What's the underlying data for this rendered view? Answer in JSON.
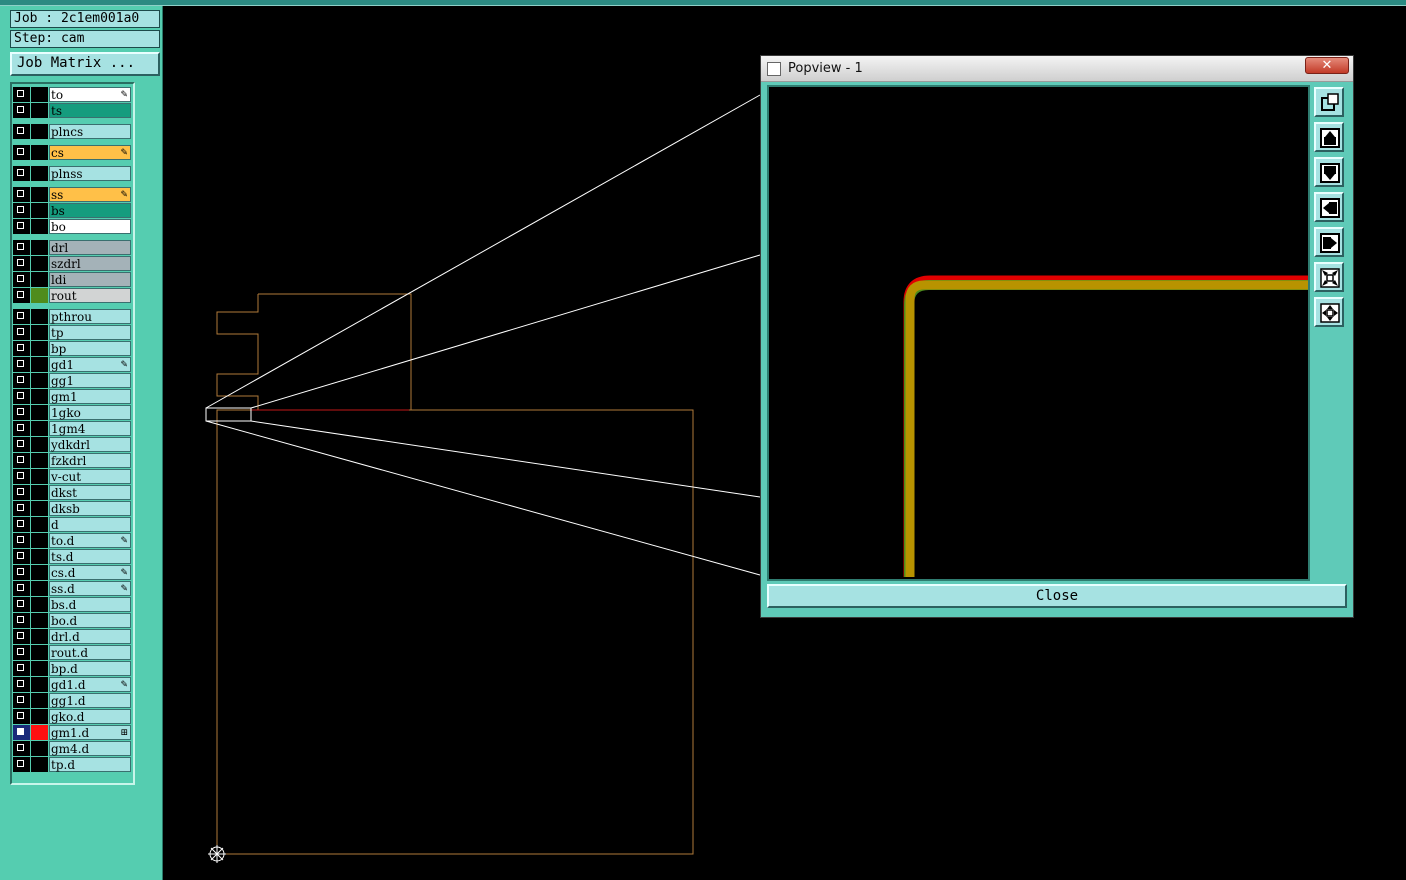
{
  "job": {
    "job_label": "Job : 2c1em001a0",
    "step_label": "Step: cam",
    "matrix_button": "Job Matrix ..."
  },
  "layers": [
    {
      "name": "to",
      "bg": "#ffffff",
      "edit": "✎",
      "checked": false,
      "swatch": ""
    },
    {
      "name": "ts",
      "bg": "#159c7e",
      "edit": "",
      "checked": false,
      "swatch": ""
    },
    {
      "name": "plncs",
      "bg": "#a6e2e2",
      "edit": "",
      "checked": false,
      "swatch": "",
      "gap": true
    },
    {
      "name": "cs",
      "bg": "#ffc048",
      "edit": "✎",
      "checked": false,
      "swatch": "",
      "gap": true
    },
    {
      "name": "plnss",
      "bg": "#a6e2e2",
      "edit": "",
      "checked": false,
      "swatch": "",
      "gap": true
    },
    {
      "name": "ss",
      "bg": "#ffc048",
      "edit": "✎",
      "checked": false,
      "swatch": "",
      "gap": true
    },
    {
      "name": "bs",
      "bg": "#159c7e",
      "edit": "",
      "checked": false,
      "swatch": ""
    },
    {
      "name": "bo",
      "bg": "#ffffff",
      "edit": "",
      "checked": false,
      "swatch": ""
    },
    {
      "name": "drl",
      "bg": "#a4b2b8",
      "edit": "",
      "checked": false,
      "swatch": "",
      "gap": true
    },
    {
      "name": "szdrl",
      "bg": "#a4b2b8",
      "edit": "",
      "checked": false,
      "swatch": ""
    },
    {
      "name": "ldi",
      "bg": "#a4b2b8",
      "edit": "",
      "checked": false,
      "swatch": ""
    },
    {
      "name": "rout",
      "bg": "#d2d4d4",
      "edit": "",
      "checked": false,
      "swatch": "#4f8c1c"
    },
    {
      "name": "pthrou",
      "bg": "#a6e2e2",
      "edit": "",
      "checked": false,
      "swatch": "",
      "gap": true
    },
    {
      "name": "tp",
      "bg": "#a6e2e2",
      "edit": "",
      "checked": false,
      "swatch": ""
    },
    {
      "name": "bp",
      "bg": "#a6e2e2",
      "edit": "",
      "checked": false,
      "swatch": ""
    },
    {
      "name": "gd1",
      "bg": "#a6e2e2",
      "edit": "✎",
      "checked": false,
      "swatch": ""
    },
    {
      "name": "gg1",
      "bg": "#a6e2e2",
      "edit": "",
      "checked": false,
      "swatch": ""
    },
    {
      "name": "gm1",
      "bg": "#a6e2e2",
      "edit": "",
      "checked": false,
      "swatch": ""
    },
    {
      "name": "1gko",
      "bg": "#a6e2e2",
      "edit": "",
      "checked": false,
      "swatch": ""
    },
    {
      "name": "1gm4",
      "bg": "#a6e2e2",
      "edit": "",
      "checked": false,
      "swatch": ""
    },
    {
      "name": "ydkdrl",
      "bg": "#a6e2e2",
      "edit": "",
      "checked": false,
      "swatch": ""
    },
    {
      "name": "fzkdrl",
      "bg": "#a6e2e2",
      "edit": "",
      "checked": false,
      "swatch": ""
    },
    {
      "name": "v-cut",
      "bg": "#a6e2e2",
      "edit": "",
      "checked": false,
      "swatch": ""
    },
    {
      "name": "dkst",
      "bg": "#a6e2e2",
      "edit": "",
      "checked": false,
      "swatch": ""
    },
    {
      "name": "dksb",
      "bg": "#a6e2e2",
      "edit": "",
      "checked": false,
      "swatch": ""
    },
    {
      "name": "d",
      "bg": "#a6e2e2",
      "edit": "",
      "checked": false,
      "swatch": ""
    },
    {
      "name": "to.d",
      "bg": "#a6e2e2",
      "edit": "✎",
      "checked": false,
      "swatch": ""
    },
    {
      "name": "ts.d",
      "bg": "#a6e2e2",
      "edit": "",
      "checked": false,
      "swatch": ""
    },
    {
      "name": "cs.d",
      "bg": "#a6e2e2",
      "edit": "✎",
      "checked": false,
      "swatch": ""
    },
    {
      "name": "ss.d",
      "bg": "#a6e2e2",
      "edit": "✎",
      "checked": false,
      "swatch": ""
    },
    {
      "name": "bs.d",
      "bg": "#a6e2e2",
      "edit": "",
      "checked": false,
      "swatch": ""
    },
    {
      "name": "bo.d",
      "bg": "#a6e2e2",
      "edit": "",
      "checked": false,
      "swatch": ""
    },
    {
      "name": "drl.d",
      "bg": "#a6e2e2",
      "edit": "",
      "checked": false,
      "swatch": ""
    },
    {
      "name": "rout.d",
      "bg": "#a6e2e2",
      "edit": "",
      "checked": false,
      "swatch": ""
    },
    {
      "name": "bp.d",
      "bg": "#a6e2e2",
      "edit": "",
      "checked": false,
      "swatch": ""
    },
    {
      "name": "gd1.d",
      "bg": "#a6e2e2",
      "edit": "✎",
      "checked": false,
      "swatch": ""
    },
    {
      "name": "gg1.d",
      "bg": "#a6e2e2",
      "edit": "",
      "checked": false,
      "swatch": ""
    },
    {
      "name": "gko.d",
      "bg": "#a6e2e2",
      "edit": "",
      "checked": false,
      "swatch": ""
    },
    {
      "name": "gm1.d",
      "bg": "#a6e2e2",
      "edit": "⊞",
      "checked": true,
      "swatch": "#ff1010",
      "cbbg": "#1a2a7a"
    },
    {
      "name": "gm4.d",
      "bg": "#a6e2e2",
      "edit": "",
      "checked": false,
      "swatch": ""
    },
    {
      "name": "tp.d",
      "bg": "#a6e2e2",
      "edit": "",
      "checked": false,
      "swatch": ""
    }
  ],
  "popview": {
    "title": "Popview - 1",
    "close_x": "✕",
    "close_label": "Close"
  },
  "toolbar_icons": [
    "zoom-fit-icon",
    "pan-up-icon",
    "pan-down-icon",
    "pan-left-icon",
    "pan-right-icon",
    "zoom-in-icon",
    "zoom-out-icon"
  ],
  "colors": {
    "panel": "#55cdb0",
    "field": "#a6e2e2",
    "profile": "#b07a3a",
    "trace": "#b89300",
    "trace_red": "#e00000",
    "trace_green": "#4f8c1c"
  }
}
